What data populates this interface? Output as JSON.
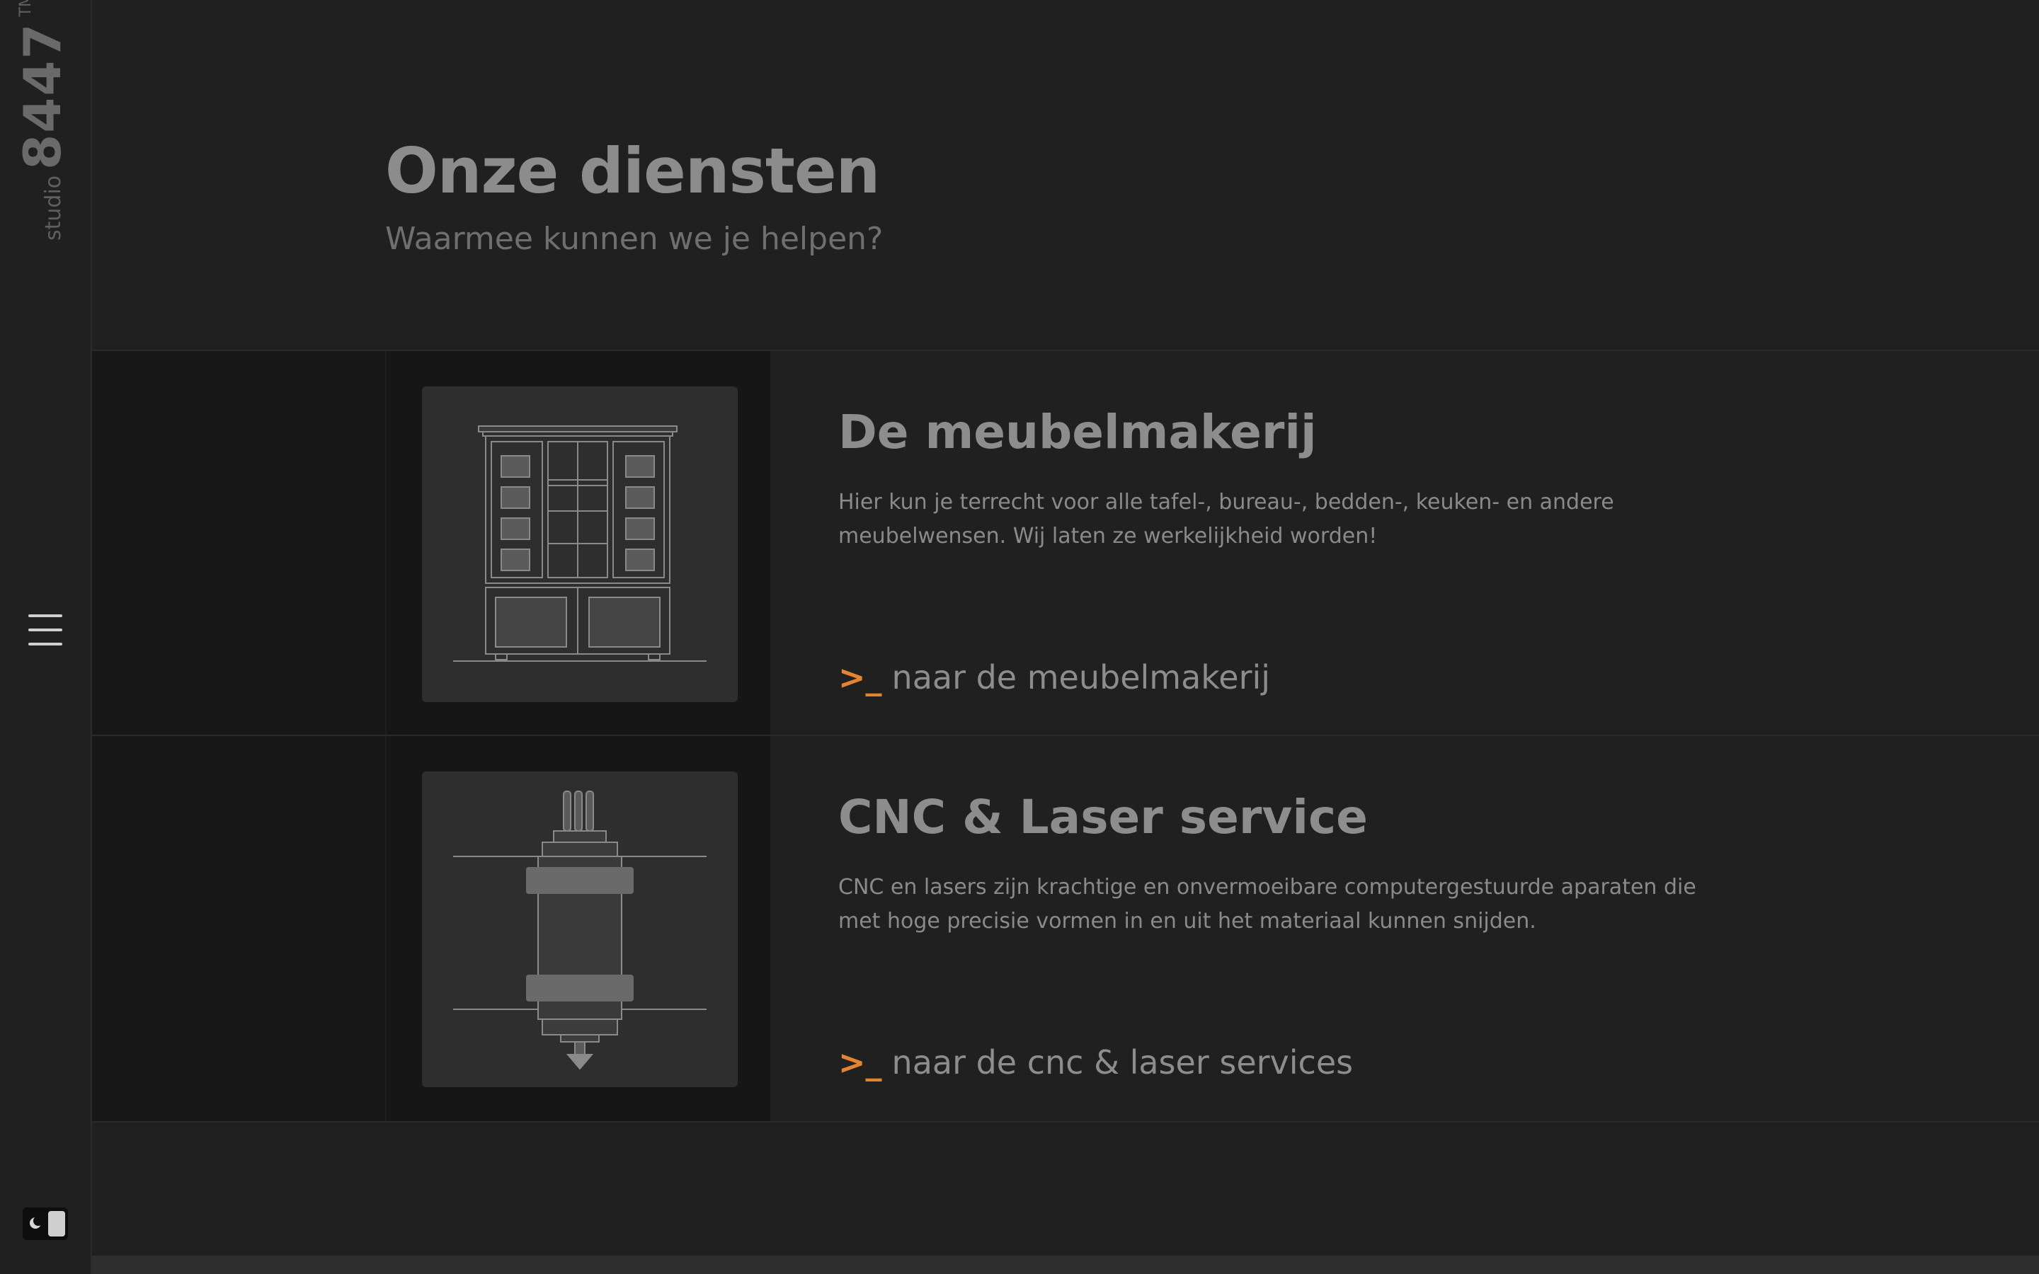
{
  "brand": {
    "prefix": "studio",
    "number": "8447",
    "trademark": "TM"
  },
  "header": {
    "title": "Onze diensten",
    "subtitle": "Waarmee kunnen we je helpen?"
  },
  "services": [
    {
      "title": "De meubelmakerij",
      "description": "Hier kun je terrecht voor alle tafel-, bureau-, bedden-, keuken- en andere meubelwensen. Wij laten ze werkelijkheid worden!",
      "link_prompt": ">_",
      "link_label": "naar de meubelmakerij",
      "icon": "cabinet-illustration"
    },
    {
      "title": "CNC & Laser service",
      "description": "CNC en lasers zijn krachtige en onvermoeibare computergestuurde aparaten die met hoge precisie vormen in en uit het materiaal kunnen snijden.",
      "link_prompt": ">_",
      "link_label": "naar de cnc & laser services",
      "icon": "cnc-spindle-illustration"
    }
  ],
  "colors": {
    "background": "#202020",
    "accent": "#e28533",
    "text": "#8a8a8a"
  }
}
